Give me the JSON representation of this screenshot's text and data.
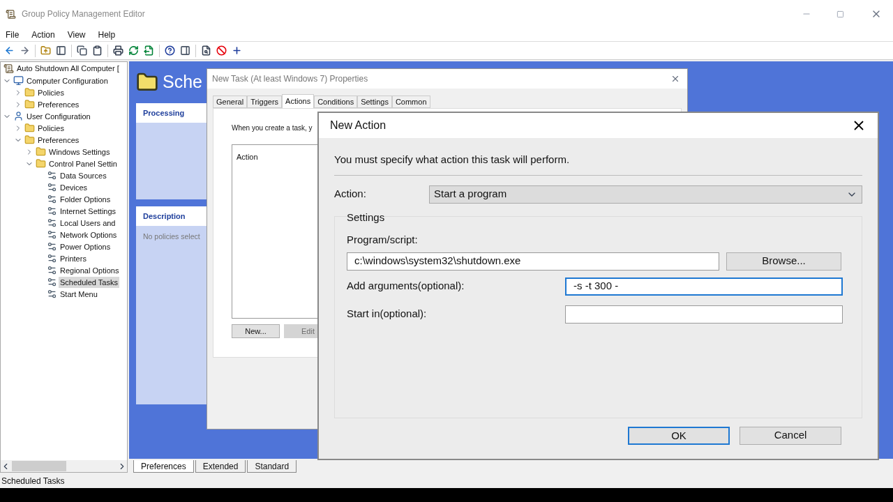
{
  "window": {
    "title": "Group Policy Management Editor"
  },
  "menu": [
    "File",
    "Action",
    "View",
    "Help"
  ],
  "tree": {
    "root": "Auto Shutdown All Computer [",
    "children": [
      {
        "label": "Computer Configuration",
        "kind": "computer",
        "expanded": true,
        "selected": false,
        "children": [
          {
            "label": "Policies",
            "kind": "folder",
            "expanded": false,
            "selected": false
          },
          {
            "label": "Preferences",
            "kind": "folder",
            "expanded": false,
            "selected": false
          }
        ]
      },
      {
        "label": "User Configuration",
        "kind": "user",
        "expanded": true,
        "selected": false,
        "children": [
          {
            "label": "Policies",
            "kind": "folder",
            "expanded": false,
            "selected": false
          },
          {
            "label": "Preferences",
            "kind": "folder",
            "expanded": true,
            "selected": false,
            "children": [
              {
                "label": "Windows Settings",
                "kind": "folder",
                "expanded": false,
                "selected": false
              },
              {
                "label": "Control Panel Settin",
                "kind": "folder",
                "expanded": true,
                "selected": false,
                "children": [
                  {
                    "label": "Data Sources",
                    "kind": "item",
                    "selected": false
                  },
                  {
                    "label": "Devices",
                    "kind": "item",
                    "selected": false
                  },
                  {
                    "label": "Folder Options",
                    "kind": "item",
                    "selected": false
                  },
                  {
                    "label": "Internet Settings",
                    "kind": "item",
                    "selected": false
                  },
                  {
                    "label": "Local Users and",
                    "kind": "item",
                    "selected": false
                  },
                  {
                    "label": "Network Options",
                    "kind": "item",
                    "selected": false
                  },
                  {
                    "label": "Power Options",
                    "kind": "item",
                    "selected": false
                  },
                  {
                    "label": "Printers",
                    "kind": "item",
                    "selected": false
                  },
                  {
                    "label": "Regional Options",
                    "kind": "item",
                    "selected": false
                  },
                  {
                    "label": "Scheduled Tasks",
                    "kind": "item",
                    "selected": true
                  },
                  {
                    "label": "Start Menu",
                    "kind": "item",
                    "selected": false
                  }
                ]
              }
            ]
          }
        ]
      }
    ]
  },
  "content": {
    "heading": "Sche",
    "panels": [
      {
        "title": "Processing"
      },
      {
        "title": "Description",
        "text": "No policies select"
      }
    ]
  },
  "bottom_tabs": [
    {
      "label": "Preferences",
      "selected": true
    },
    {
      "label": "Extended",
      "selected": false
    },
    {
      "label": "Standard",
      "selected": false
    }
  ],
  "status_bar": "Scheduled Tasks",
  "properties_dialog": {
    "title": "New Task (At least Windows 7) Properties",
    "tabs": [
      {
        "label": "General",
        "selected": false
      },
      {
        "label": "Triggers",
        "selected": false
      },
      {
        "label": "Actions",
        "selected": true
      },
      {
        "label": "Conditions",
        "selected": false
      },
      {
        "label": "Settings",
        "selected": false
      },
      {
        "label": "Common",
        "selected": false
      }
    ],
    "intro": "When you create a task, y",
    "list_header": "Action",
    "buttons": [
      {
        "label": "New...",
        "disabled": false
      },
      {
        "label": "Edit",
        "disabled": true
      }
    ]
  },
  "new_action_dialog": {
    "title": "New Action",
    "prompt": "You must specify what action this task will perform.",
    "action_label": "Action:",
    "action_value": "Start a program",
    "settings_label": "Settings",
    "fields": [
      {
        "label": "Program/script:",
        "value": "c:\\windows\\system32\\shutdown.exe",
        "focused": false
      },
      {
        "label": "Add arguments(optional):",
        "value": "-s -t 300 -",
        "focused": true
      },
      {
        "label": "Start in(optional):",
        "focused": false
      }
    ],
    "browse": "Browse...",
    "buttons": [
      {
        "label": "OK",
        "default": true
      },
      {
        "label": "Cancel",
        "default": false
      }
    ]
  }
}
